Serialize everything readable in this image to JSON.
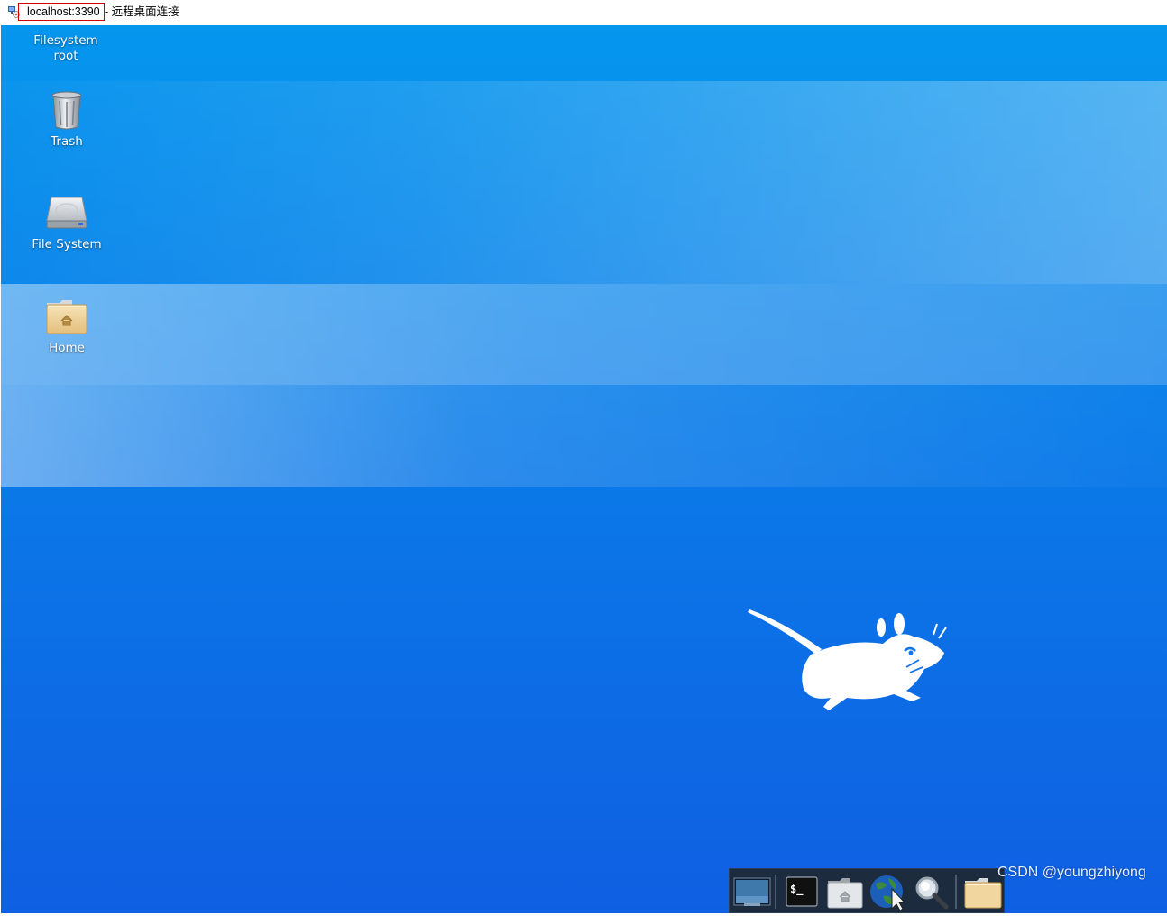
{
  "window": {
    "host": "localhost:3390",
    "title_suffix": "- 远程桌面连接",
    "highlight_color": "#d40000"
  },
  "desktop": {
    "colors": {
      "top": "#0596ee",
      "bottom": "#0f5fe2",
      "label": "#ffffff"
    },
    "icons": [
      {
        "label": "Filesystem\nroot",
        "icon": "none"
      },
      {
        "label": "Trash",
        "icon": "trash-icon"
      },
      {
        "label": "File System",
        "icon": "hard-drive-icon"
      },
      {
        "label": "Home",
        "icon": "home-folder-icon"
      }
    ],
    "logo": "xfce-mouse-icon"
  },
  "dock": {
    "items": [
      {
        "name": "show-desktop",
        "icon": "desktop-icon"
      },
      {
        "name": "terminal",
        "icon": "terminal-icon"
      },
      {
        "name": "file-manager",
        "icon": "home-folder-icon"
      },
      {
        "name": "web-browser",
        "icon": "globe-icon"
      },
      {
        "name": "app-finder",
        "icon": "magnifier-icon"
      },
      {
        "name": "folder",
        "icon": "folder-icon"
      }
    ],
    "background": "#1d2b3f"
  },
  "watermark": "CSDN @youngzhiyong"
}
